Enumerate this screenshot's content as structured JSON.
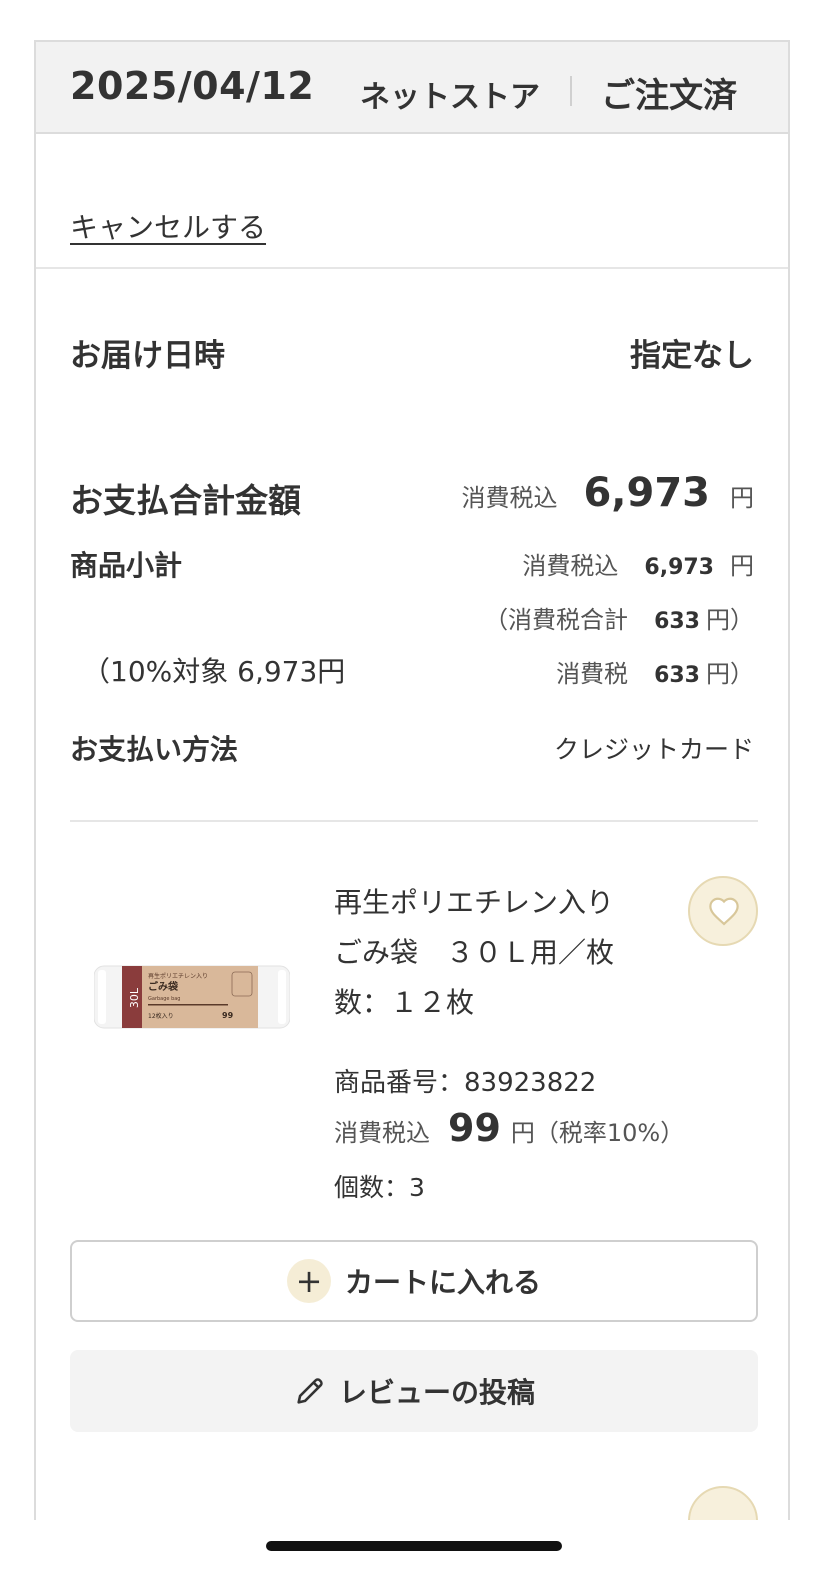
{
  "order": {
    "date": "2025/04/12",
    "store": "ネットストア",
    "status": "ご注文済",
    "cancel_link": "キャンセルする"
  },
  "delivery": {
    "label": "お届け日時",
    "value": "指定なし"
  },
  "payment_total": {
    "label": "お支払合計金額",
    "tax_label": "消費税込",
    "amount": "6,973",
    "currency": "円"
  },
  "subtotal": {
    "label": "商品小計",
    "tax_label": "消費税込",
    "amount": "6,973",
    "currency": "円",
    "tax_total_prefix": "（消費税合計",
    "tax_total_amount": "633",
    "tax_total_suffix": "円）",
    "target": "（10%対象 6,973円",
    "tax_label2": "消費税",
    "tax_amount": "633",
    "tax_suffix": "円）"
  },
  "payment_method": {
    "label": "お支払い方法",
    "value": "クレジットカード"
  },
  "product": {
    "name": "再生ポリエチレン入り　ごみ袋　３０Ｌ用／枚数：１２枚",
    "number": "商品番号：83923822",
    "tax_label": "消費税込",
    "price": "99",
    "price_suffix": "円（税率10%）",
    "quantity": "個数：3",
    "image_labels": {
      "size": "30L",
      "title": "ごみ袋",
      "subtitle": "再生ポリエチレン入り",
      "english": "Garbage bag",
      "count": "12枚入り",
      "price": "99"
    }
  },
  "actions": {
    "add_to_cart": "カートに入れる",
    "post_review": "レビューの投稿"
  },
  "colors": {
    "accent_beige": "#f5edd6",
    "label_brown": "#8a3c3c",
    "header_bg": "#f2f2f2"
  }
}
